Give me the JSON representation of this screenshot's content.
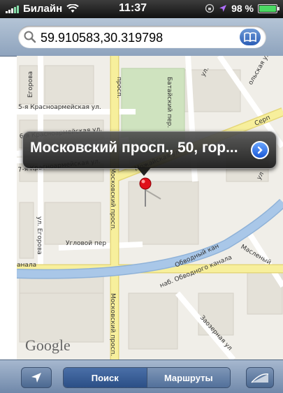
{
  "status_bar": {
    "carrier": "Билайн",
    "time": "11:37",
    "battery": "98 %",
    "battery_level": 0.98
  },
  "search": {
    "value": "59.910583,30.319798",
    "icon": "search-icon",
    "bookmarks_icon": "bookmarks-book-icon"
  },
  "map": {
    "streets": {
      "egorova_top": "Егорова",
      "krasnoarm_5": "5-я Красноармейская ул.",
      "krasnoarm_6": "6-я Красноармейская ул.",
      "krasnoarm_7": "7-я Красноармейская ул.",
      "prosp_top": "просп.",
      "batayskiy": "Батайский пер.",
      "ul_top": "ул.",
      "dolskaya": "ольская ул.",
      "serp": "Серп",
      "ul_right": "ул",
      "ul_egorova": "ул. Егорова",
      "moskovskiy": "Московский просп.",
      "moskovskiy_bottom": "Московский просп.",
      "mozhayskaya": "Можайская ул.",
      "uglovoy": "Угловой пер",
      "obvodniy_kan": "Обводный кан",
      "nab_obvodnogo": "наб. Обводного канала",
      "kanala": "анала",
      "maslenniy": "Масленый",
      "zaozernaya": "Заозерная ул"
    },
    "callout": {
      "title": "Московский просп., 50, гор...",
      "disclosure_icon": "disclosure-arrow-icon"
    },
    "pin_icon": "red-map-pin-icon",
    "attribution": "Google"
  },
  "toolbar": {
    "locate_icon": "location-arrow-icon",
    "segments": [
      "Поиск",
      "Маршруты"
    ],
    "selected_segment": "Поиск",
    "curl_icon": "page-curl-icon"
  },
  "colors": {
    "status_green": "#4cd964",
    "pin_red": "#e0101a",
    "canal_blue": "#a9c7e8",
    "main_road_yellow": "#f7ef9c",
    "park_green": "#cfe3bf"
  }
}
